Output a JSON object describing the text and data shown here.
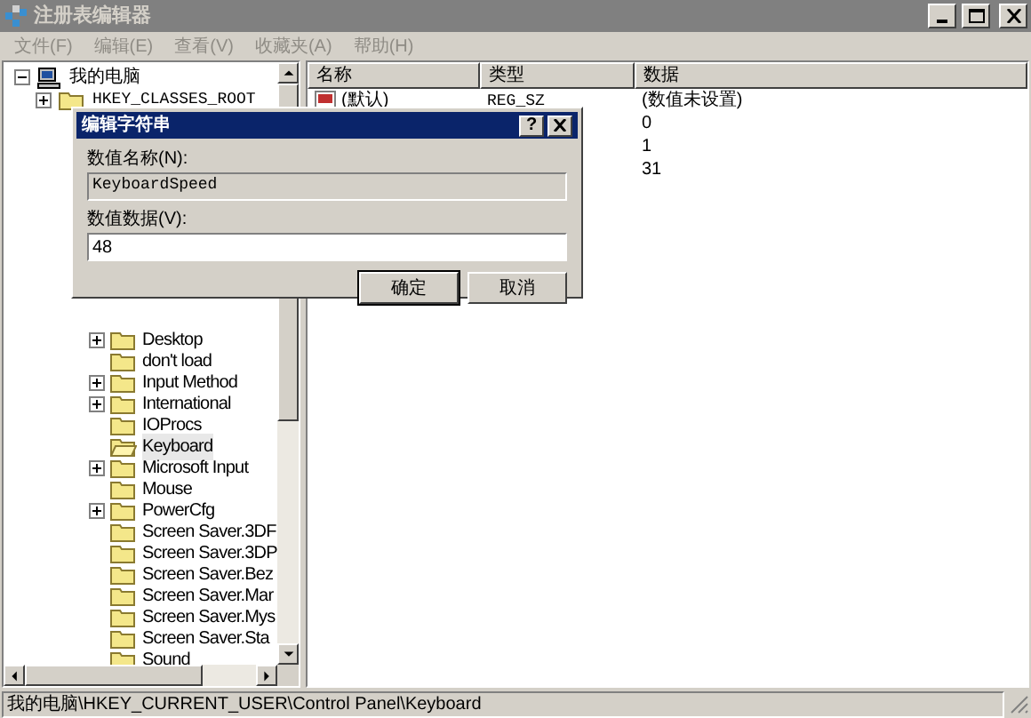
{
  "window": {
    "title": "注册表编辑器",
    "active": false
  },
  "menu": [
    {
      "label": "文件(F)",
      "disabled": true
    },
    {
      "label": "编辑(E)",
      "disabled": true
    },
    {
      "label": "查看(V)",
      "disabled": true
    },
    {
      "label": "收藏夹(A)",
      "disabled": true
    },
    {
      "label": "帮助(H)",
      "disabled": true
    }
  ],
  "tree": {
    "label": "我的电脑",
    "expanded": true,
    "children": [
      {
        "label": "HKEY_CLASSES_ROOT",
        "expanded": false
      }
    ]
  },
  "tree_lower": [
    {
      "label": "Desktop",
      "expandable": true,
      "selected": false
    },
    {
      "label": "don't load",
      "expandable": false,
      "selected": false
    },
    {
      "label": "Input Method",
      "expandable": true,
      "selected": false
    },
    {
      "label": "International",
      "expandable": true,
      "selected": false
    },
    {
      "label": "IOProcs",
      "expandable": false,
      "selected": false
    },
    {
      "label": "Keyboard",
      "expandable": false,
      "selected": true
    },
    {
      "label": "Microsoft Input",
      "expandable": true,
      "selected": false
    },
    {
      "label": "Mouse",
      "expandable": false,
      "selected": false
    },
    {
      "label": "PowerCfg",
      "expandable": true,
      "selected": false
    },
    {
      "label": "Screen Saver.3DF",
      "expandable": false,
      "selected": false
    },
    {
      "label": "Screen Saver.3DP",
      "expandable": false,
      "selected": false
    },
    {
      "label": "Screen Saver.Bez",
      "expandable": false,
      "selected": false
    },
    {
      "label": "Screen Saver.Mar",
      "expandable": false,
      "selected": false
    },
    {
      "label": "Screen Saver.Mys",
      "expandable": false,
      "selected": false
    },
    {
      "label": "Screen Saver.Sta",
      "expandable": false,
      "selected": false
    },
    {
      "label": "Sound",
      "expandable": false,
      "selected": false
    }
  ],
  "table": {
    "columns": [
      "名称",
      "类型",
      "数据"
    ],
    "rows": [
      {
        "name": "(默认)",
        "type": "REG_SZ",
        "data": "(数值未设置)"
      },
      {
        "data": "0"
      },
      {
        "data": "1"
      },
      {
        "data": "31"
      }
    ]
  },
  "status_bar": "我的电脑\\HKEY_CURRENT_USER\\Control Panel\\Keyboard",
  "dialog": {
    "title": "编辑字符串",
    "help": "?",
    "name_label": "数值名称(N):",
    "name_value": "KeyboardSpeed",
    "data_label": "数值数据(V):",
    "data_value": "48",
    "buttons": [
      {
        "label": "确定",
        "default": true
      },
      {
        "label": "取消",
        "default": false
      }
    ]
  }
}
